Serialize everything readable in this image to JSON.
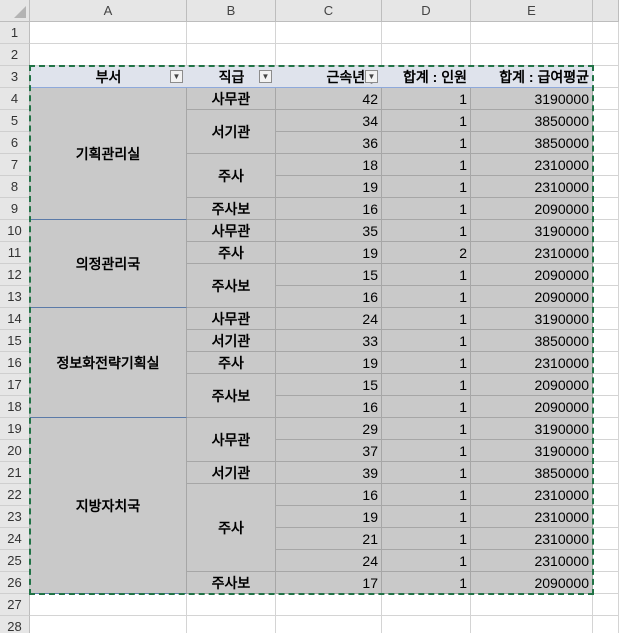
{
  "columns": [
    "A",
    "B",
    "C",
    "D",
    "E"
  ],
  "rows": [
    "1",
    "2",
    "3",
    "4",
    "5",
    "6",
    "7",
    "8",
    "9",
    "10",
    "11",
    "12",
    "13",
    "14",
    "15",
    "16",
    "17",
    "18",
    "19",
    "20",
    "21",
    "22",
    "23",
    "24",
    "25",
    "26",
    "27",
    "28"
  ],
  "pivot": {
    "headers": {
      "dept": "부서",
      "rank": "직급",
      "years": "근속년수",
      "count": "합계 : 인원",
      "salary": "합계 : 급여평균"
    },
    "depts": [
      {
        "label": "기획관리실",
        "start": 4,
        "end": 9
      },
      {
        "label": "의정관리국",
        "start": 10,
        "end": 13
      },
      {
        "label": "정보화전략기획실",
        "start": 14,
        "end": 18
      },
      {
        "label": "지방자치국",
        "start": 19,
        "end": 26
      }
    ],
    "ranks": [
      {
        "label": "사무관",
        "start": 4,
        "end": 4
      },
      {
        "label": "서기관",
        "start": 5,
        "end": 6
      },
      {
        "label": "주사",
        "start": 7,
        "end": 8
      },
      {
        "label": "주사보",
        "start": 9,
        "end": 9
      },
      {
        "label": "사무관",
        "start": 10,
        "end": 10
      },
      {
        "label": "주사",
        "start": 11,
        "end": 11
      },
      {
        "label": "주사보",
        "start": 12,
        "end": 13
      },
      {
        "label": "사무관",
        "start": 14,
        "end": 14
      },
      {
        "label": "서기관",
        "start": 15,
        "end": 15
      },
      {
        "label": "주사",
        "start": 16,
        "end": 16
      },
      {
        "label": "주사보",
        "start": 17,
        "end": 18
      },
      {
        "label": "사무관",
        "start": 19,
        "end": 20
      },
      {
        "label": "서기관",
        "start": 21,
        "end": 21
      },
      {
        "label": "주사",
        "start": 22,
        "end": 25
      },
      {
        "label": "주사보",
        "start": 26,
        "end": 26
      }
    ],
    "values": [
      {
        "years": "42",
        "count": "1",
        "salary": "3190000"
      },
      {
        "years": "34",
        "count": "1",
        "salary": "3850000"
      },
      {
        "years": "36",
        "count": "1",
        "salary": "3850000"
      },
      {
        "years": "18",
        "count": "1",
        "salary": "2310000"
      },
      {
        "years": "19",
        "count": "1",
        "salary": "2310000"
      },
      {
        "years": "16",
        "count": "1",
        "salary": "2090000"
      },
      {
        "years": "35",
        "count": "1",
        "salary": "3190000"
      },
      {
        "years": "19",
        "count": "2",
        "salary": "2310000"
      },
      {
        "years": "15",
        "count": "1",
        "salary": "2090000"
      },
      {
        "years": "16",
        "count": "1",
        "salary": "2090000"
      },
      {
        "years": "24",
        "count": "1",
        "salary": "3190000"
      },
      {
        "years": "33",
        "count": "1",
        "salary": "3850000"
      },
      {
        "years": "19",
        "count": "1",
        "salary": "2310000"
      },
      {
        "years": "15",
        "count": "1",
        "salary": "2090000"
      },
      {
        "years": "16",
        "count": "1",
        "salary": "2090000"
      },
      {
        "years": "29",
        "count": "1",
        "salary": "3190000"
      },
      {
        "years": "37",
        "count": "1",
        "salary": "3190000"
      },
      {
        "years": "39",
        "count": "1",
        "salary": "3850000"
      },
      {
        "years": "16",
        "count": "1",
        "salary": "2310000"
      },
      {
        "years": "19",
        "count": "1",
        "salary": "2310000"
      },
      {
        "years": "21",
        "count": "1",
        "salary": "2310000"
      },
      {
        "years": "24",
        "count": "1",
        "salary": "2310000"
      },
      {
        "years": "17",
        "count": "1",
        "salary": "2090000"
      }
    ]
  },
  "filter_icon": "dropdown-arrow-icon",
  "colors": {
    "selection": "#217346",
    "pivot_fill": "#c9c9c9",
    "header_fill": "#dfe3ec"
  }
}
